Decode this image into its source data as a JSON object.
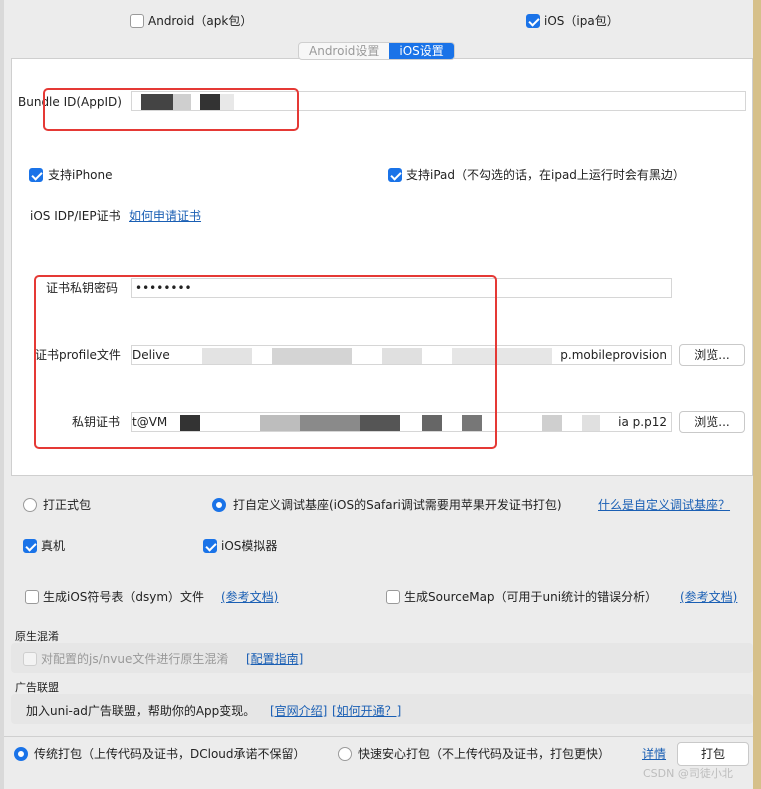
{
  "platforms": {
    "android_label": "Android（apk包）",
    "ios_label": "iOS（ipa包）",
    "android_checked": false,
    "ios_checked": true
  },
  "tabs": [
    {
      "label": "Android设置",
      "active": false
    },
    {
      "label": "iOS设置",
      "active": true
    }
  ],
  "ios": {
    "bundle_id_label": "Bundle ID(AppID)",
    "support_iphone_label": "支持iPhone",
    "support_ipad_label": "支持iPad（不勾选的话，在ipad上运行时会有黑边）",
    "cert_label": "iOS IDP/IEP证书",
    "cert_link": "如何申请证书",
    "cert_password_label": "证书私钥密码",
    "cert_password_value": "••••••••",
    "profile_label": "证书profile文件",
    "profile_value_start": "Delive",
    "profile_value_end": "p.mobileprovision",
    "private_key_label": "私钥证书",
    "private_key_value_start": "t@VM",
    "private_key_value_end": "ia  p.p12",
    "browse_label": "浏览..."
  },
  "package_type": {
    "release_label": "打正式包",
    "debug_base_label": "打自定义调试基座(iOS的Safari调试需要用苹果开发证书打包)",
    "debug_base_link": "什么是自定义调试基座？",
    "real_device_label": "真机",
    "simulator_label": "iOS模拟器"
  },
  "options": {
    "dsym_label": "生成iOS符号表（dsym）文件",
    "dsym_link": "(参考文档)",
    "sourcemap_label": "生成SourceMap（可用于uni统计的错误分析）",
    "sourcemap_link": "(参考文档)"
  },
  "obfuscation": {
    "section_title": "原生混淆",
    "checkbox_label": "对配置的js/nvue文件进行原生混淆",
    "guide_link": "[配置指南]"
  },
  "ads": {
    "section_title": "广告联盟",
    "text": "加入uni-ad广告联盟，帮助你的App变现。",
    "intro_link": "[官网介绍]",
    "open_link": "[如何开通？]"
  },
  "bottom": {
    "traditional_label": "传统打包（上传代码及证书，DCloud承诺不保留）",
    "fast_label": "快速安心打包（不上传代码及证书，打包更快）",
    "detail_link": "详情",
    "build_button": "打包",
    "watermark": "CSDN @司徒小北"
  },
  "colors": {
    "accent": "#1a73e8",
    "highlight_box": "#e53935",
    "link": "#1a5fb4"
  }
}
